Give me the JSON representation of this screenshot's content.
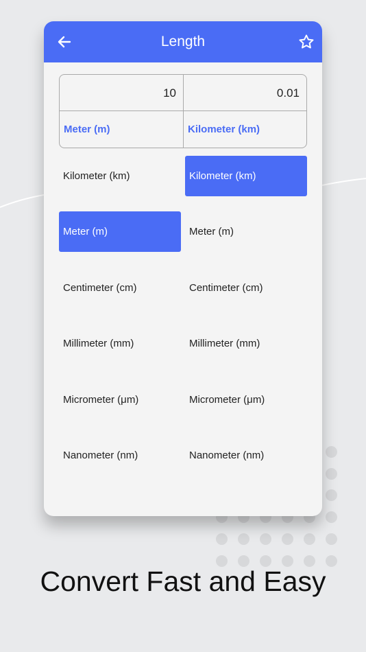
{
  "app": {
    "title": "Length",
    "back_icon": "arrow-left-icon",
    "favorite_icon": "star-outline-icon"
  },
  "converter": {
    "from_value": "10",
    "to_value": "0.01",
    "from_unit": "Meter (m)",
    "to_unit": "Kilometer (km)"
  },
  "units_from": [
    {
      "label": "Kilometer (km)",
      "selected": false
    },
    {
      "label": "Meter (m)",
      "selected": true
    },
    {
      "label": "Centimeter (cm)",
      "selected": false
    },
    {
      "label": "Millimeter (mm)",
      "selected": false
    },
    {
      "label": "Micrometer (μm)",
      "selected": false
    },
    {
      "label": "Nanometer (nm)",
      "selected": false
    }
  ],
  "units_to": [
    {
      "label": "Kilometer (km)",
      "selected": true
    },
    {
      "label": "Meter (m)",
      "selected": false
    },
    {
      "label": "Centimeter (cm)",
      "selected": false
    },
    {
      "label": "Millimeter (mm)",
      "selected": false
    },
    {
      "label": "Micrometer (μm)",
      "selected": false
    },
    {
      "label": "Nanometer (nm)",
      "selected": false
    }
  ],
  "tagline": "Convert Fast and Easy",
  "colors": {
    "accent": "#4a6cf5",
    "background": "#e9eaec",
    "card": "#f4f4f4"
  }
}
